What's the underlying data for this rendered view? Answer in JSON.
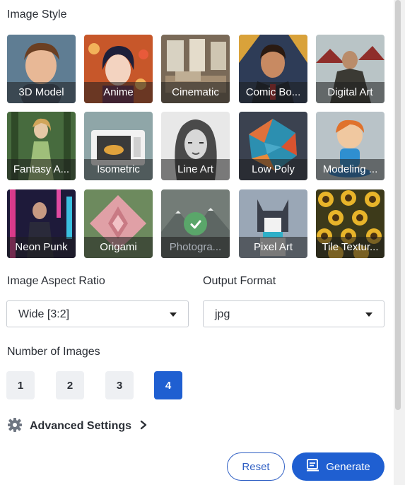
{
  "image_style": {
    "title": "Image Style",
    "tiles": [
      {
        "label": "3D Model"
      },
      {
        "label": "Anime"
      },
      {
        "label": "Cinematic"
      },
      {
        "label": "Comic Bo..."
      },
      {
        "label": "Digital Art"
      },
      {
        "label": "Fantasy A..."
      },
      {
        "label": "Isometric"
      },
      {
        "label": "Line Art"
      },
      {
        "label": "Low Poly"
      },
      {
        "label": "Modeling ..."
      },
      {
        "label": "Neon Punk"
      },
      {
        "label": "Origami"
      },
      {
        "label": "Photogra...",
        "selected": true
      },
      {
        "label": "Pixel Art"
      },
      {
        "label": "Tile Textur..."
      }
    ]
  },
  "aspect_ratio": {
    "label": "Image Aspect Ratio",
    "value": "Wide [3:2]"
  },
  "output_format": {
    "label": "Output Format",
    "value": "jpg"
  },
  "number_of_images": {
    "label": "Number of Images",
    "options": [
      "1",
      "2",
      "3",
      "4"
    ],
    "selected": "4"
  },
  "advanced": {
    "label": "Advanced Settings"
  },
  "actions": {
    "reset": "Reset",
    "generate": "Generate"
  },
  "colors": {
    "accent": "#1f5fd1",
    "check": "#5aa66a"
  }
}
